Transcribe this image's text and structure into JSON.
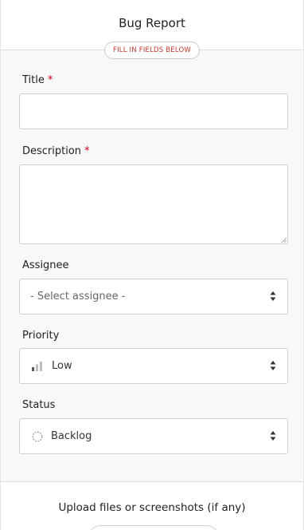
{
  "header": {
    "title": "Bug Report",
    "instruction": "FILL IN FIELDS BELOW"
  },
  "form": {
    "title": {
      "label": "Title",
      "required": "*",
      "value": ""
    },
    "description": {
      "label": "Description",
      "required": "*",
      "value": ""
    },
    "assignee": {
      "label": "Assignee",
      "value": "- Select assignee -"
    },
    "priority": {
      "label": "Priority",
      "value": "Low",
      "icon": "priority-low-icon"
    },
    "status": {
      "label": "Status",
      "value": "Backlog",
      "icon": "backlog-circle-icon"
    }
  },
  "upload": {
    "text": "Upload files or screenshots (if any)"
  },
  "colors": {
    "required": "#d0021b",
    "instruction": "#c0392b",
    "background": "#f8f8f8"
  }
}
